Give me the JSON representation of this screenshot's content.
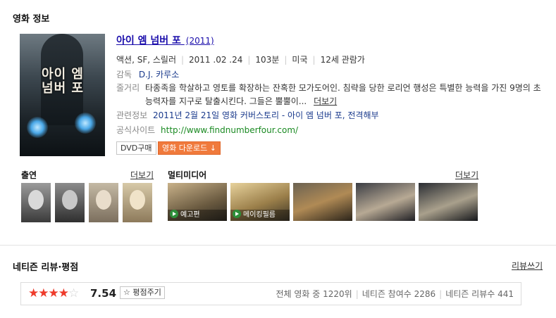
{
  "section_title": "영화 정보",
  "poster": {
    "title_line1": "아이 엠",
    "title_line2": "넘버 포"
  },
  "movie": {
    "title": "아이 엠 넘버 포",
    "year": "(2011)",
    "genre": "액션, SF, 스릴러",
    "release_date": "2011 .02 .24",
    "runtime": "103분",
    "country": "미국",
    "rating": "12세 관람가",
    "director_label": "감독",
    "director": "D.J. 카루소",
    "synopsis_label": "줄거리",
    "synopsis_text": "타종족을 학살하고 영토를 확장하는 잔혹한 모가도어인. 침략을 당한 로리언 행성은 특별한 능력을 가진 9명의 초능력자를 지구로 탈출시킨다. 그들은 뿔뿔이...",
    "synopsis_more": "더보기",
    "related_label": "관련정보",
    "related_text": "2011년 2월 21일 영화 커버스토리 - 아이 엠 넘버 포, 전격해부",
    "site_label": "공식사이트",
    "site_url": "http://www.findnumberfour.com/"
  },
  "buttons": {
    "dvd": "DVD구매",
    "download": "영화 다운로드 ↓"
  },
  "cast": {
    "title": "출연",
    "more": "더보기",
    "people": [
      {
        "name": "cast-1"
      },
      {
        "name": "cast-2"
      },
      {
        "name": "cast-3"
      },
      {
        "name": "cast-4"
      }
    ]
  },
  "multimedia": {
    "title": "멀티미디어",
    "more": "더보기",
    "items": [
      {
        "caption": "예고편"
      },
      {
        "caption": "메이킹필름"
      },
      {
        "caption": ""
      },
      {
        "caption": ""
      },
      {
        "caption": ""
      }
    ]
  },
  "reviews": {
    "title": "네티즌 리뷰·평점",
    "write": "리뷰쓰기",
    "stars_filled": 4,
    "stars_total": 5,
    "score": "7.54",
    "rate_button": "☆ 평점주기",
    "rank": "전체 영화 중 1220위",
    "participants": "네티즌 참여수 2286",
    "review_count": "네티즌 리뷰수 441"
  },
  "colors": {
    "link": "#1a0dab",
    "download": "#f07a3c",
    "star": "#ee3b2b",
    "url": "#1a8a22"
  }
}
